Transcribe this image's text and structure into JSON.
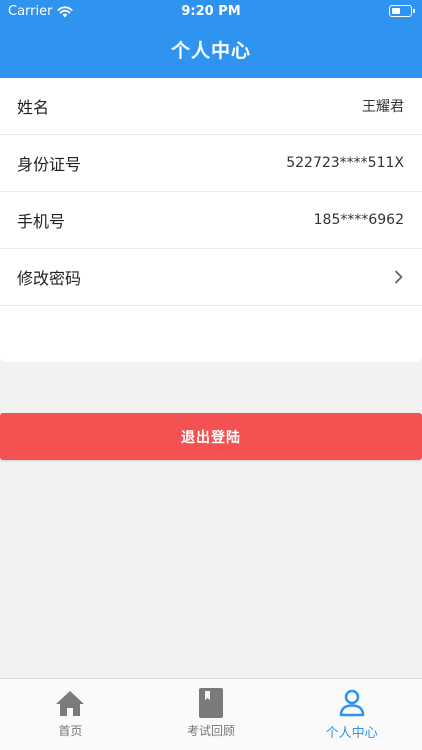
{
  "status_bar": {
    "carrier": "Carrier",
    "time": "9:20 PM"
  },
  "header": {
    "title": "个人中心",
    "color": "#2f93f0"
  },
  "profile": {
    "rows": [
      {
        "label": "姓名",
        "value": "王耀君"
      },
      {
        "label": "身份证号",
        "value": "522723****511X"
      },
      {
        "label": "手机号",
        "value": "185****6962"
      },
      {
        "label": "修改密码",
        "icon": "chevron-right-icon"
      }
    ]
  },
  "logout": {
    "label": "退出登陆",
    "color": "#f45252"
  },
  "tabbar": {
    "tabs": [
      {
        "label": "首页",
        "icon": "home-icon"
      },
      {
        "label": "考试回顾",
        "icon": "book-icon"
      },
      {
        "label": "个人中心",
        "icon": "user-icon",
        "active": true
      }
    ],
    "active_color": "#2f93f0"
  }
}
